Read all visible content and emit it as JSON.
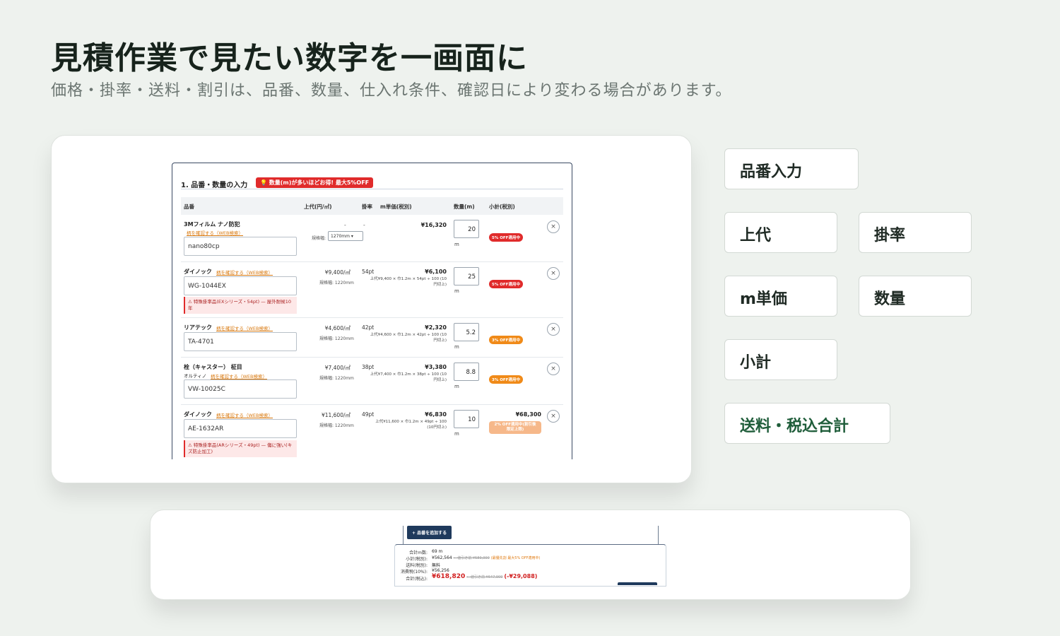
{
  "hero": {
    "title": "見積作業で見たい数字を一画面に",
    "subtitle": "価格・掛率・送料・割引は、品番、数量、仕入れ条件、確認日により変わる場合があります。"
  },
  "form": {
    "section_title": "1. 品番・数量の入力",
    "promo_banner": "💡 数量(m)が多いほどお得! 最大5%OFF",
    "columns": [
      "品番",
      "上代(円/㎡)",
      "掛率",
      "m単価(税別)",
      "数量(m)",
      "小計(税別)"
    ],
    "rows": [
      {
        "name": "3Mフィルム ナノ防犯",
        "link": "柄を確認する（WEB検索）",
        "code": "nano80cp",
        "list_price": "-",
        "rate": "-",
        "width_label": "規格幅:",
        "width_select": "1270mm ▾",
        "unit_price": "¥16,320",
        "qty": "20",
        "unit": "m",
        "badge": "5% OFF適用中",
        "remove": "×"
      },
      {
        "name": "ダイノック",
        "link": "柄を確認する（WEB検索）",
        "code": "WG-1044EX",
        "warning": "⚠ 特殊掛率品(EXシリーズ・54pt) — 屋外耐候10年",
        "list_price": "¥9,400/㎡",
        "spec": "規格幅: 1220mm",
        "rate": "54pt",
        "unit_price": "¥6,100",
        "calc": "上代¥9,400 × 巾1.2m × 54pt ÷ 100 (10円切上)",
        "qty": "25",
        "unit": "m",
        "badge": "5% OFF適用中",
        "remove": "×"
      },
      {
        "name": "リアテック",
        "link": "柄を確認する（WEB検索）",
        "code": "TA-4701",
        "list_price": "¥4,600/㎡",
        "spec": "規格幅: 1220mm",
        "rate": "42pt",
        "unit_price": "¥2,320",
        "calc": "上代¥4,600 × 巾1.2m × 42pt ÷ 100 (10円切上)",
        "qty": "5.2",
        "unit": "m",
        "badge": "3% OFF適用中",
        "remove": "×"
      },
      {
        "name": "栓（キャスター） 柾目",
        "maker": "オルティノ",
        "link": "柄を確認する（WEB検索）",
        "code": "VW-10025C",
        "list_price": "¥7,400/㎡",
        "spec": "規格幅: 1220mm",
        "rate": "38pt",
        "unit_price": "¥3,380",
        "calc": "上代¥7,400 × 巾1.2m × 38pt ÷ 100 (10円切上)",
        "qty": "8.8",
        "unit": "m",
        "badge": "3% OFF適用中",
        "remove": "×"
      },
      {
        "name": "ダイノック",
        "link": "柄を確認する（WEB検索）",
        "code": "AE-1632AR",
        "warning": "⚠ 特殊掛率品(ARシリーズ・49pt) — 傷に強い(キズ防止加工)",
        "list_price": "¥11,600/㎡",
        "spec": "規格幅: 1220mm",
        "rate": "49pt",
        "unit_price": "¥6,830",
        "calc": "上代¥11,600 × 巾1.2m × 49pt ÷ 100 (10円切上)",
        "qty": "10",
        "unit": "m",
        "subtotal": "¥68,300",
        "badge": "2% OFF適用中(割引後 限定上限)",
        "remove": "×"
      }
    ]
  },
  "summary": {
    "add_button": "+ 品番を追加する",
    "total_m_label": "合計m数:",
    "total_m": "69 m",
    "subtotal_label": "小計(税別):",
    "subtotal": "¥562,564",
    "subtotal_before": "← 値引き前 ¥589,000",
    "subtotal_note": "(最優先割 最大5% OFF適用中)",
    "shipping_label": "送料(税別):",
    "shipping": "無料",
    "tax_label": "消費税(10%):",
    "tax": "¥56,256",
    "total_label": "合計(税込):",
    "total": "¥618,820",
    "total_before": "← 値引き前 ¥647,909",
    "savings": "(-¥29,088)"
  },
  "chips": {
    "part_no": "品番入力",
    "list_price": "上代",
    "rate": "掛率",
    "m_price": "m単価",
    "qty": "数量",
    "subtotal": "小計",
    "shipping_total": "送料・税込合計"
  },
  "colors": {
    "background": "#eef2ee",
    "accent_red": "#e02b2b",
    "accent_orange": "#f08a18",
    "navy": "#1f3a5c",
    "green_text": "#1f5d3a"
  }
}
